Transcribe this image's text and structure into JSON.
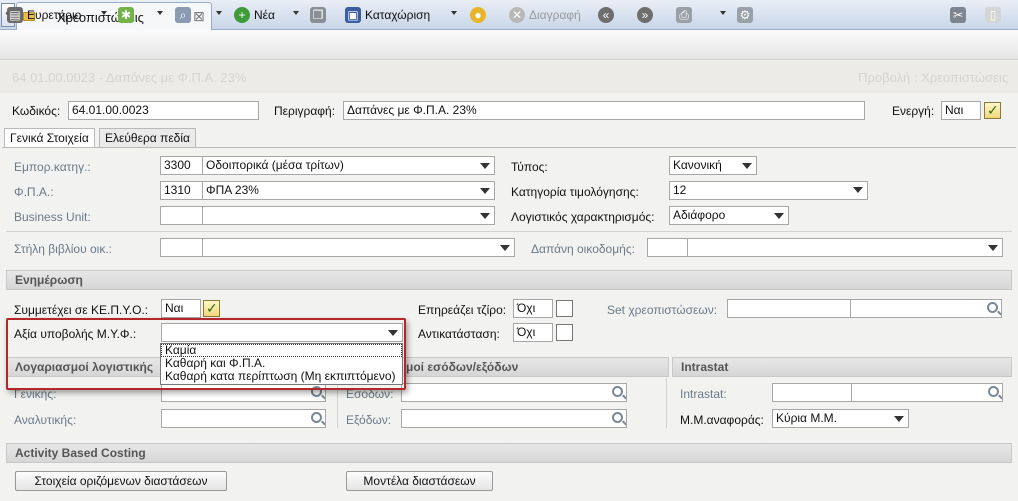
{
  "tabbar": {
    "tab_title": "Χρεοπιστώσεις",
    "close": "⊠"
  },
  "toolbar": {
    "index": "Ευρετήριο",
    "new": "Νέα",
    "save": "Καταχώριση",
    "delete": "Διαγραφή"
  },
  "record": {
    "code_and_desc": "64.01.00.0023 - Δαπάνες με Φ.Π.Α. 23%",
    "mode": "Προβολή : Χρεοπιστώσεις"
  },
  "header": {
    "code_label": "Κωδικός:",
    "code_value": "64.01.00.0023",
    "desc_label": "Περιγραφή:",
    "desc_value": "Δαπάνες με Φ.Π.Α. 23%",
    "active_label": "Ενεργή:",
    "active_value": "Ναι"
  },
  "tabs": [
    "Γενικά Στοιχεία",
    "Ελεύθερα πεδία"
  ],
  "general": {
    "emp_label": "Εμπορ.κατηγ.:",
    "emp_code": "3300",
    "emp_name": "Οδοιπορικά (μέσα τρίτων)",
    "vat_label": "Φ.Π.Α.:",
    "vat_code": "1310",
    "vat_name": "ΦΠΑ 23%",
    "bu_label": "Business Unit:",
    "type_label": "Τύπος:",
    "type_value": "Κανονική",
    "billcat_label": "Κατηγορία τιμολόγησης:",
    "billcat_value": "12",
    "acct_label": "Λογιστικός χαρακτηρισμός:",
    "acct_value": "Αδιάφορο",
    "col_label": "Στήλη βιβλίου οικ.:",
    "build_label": "Δαπάνη οικοδομής:"
  },
  "update": {
    "title": "Ενημέρωση",
    "kepyo_label": "Συμμετέχει σε ΚΕ.Π.Υ.Ο.:",
    "kepyo_value": "Ναι",
    "turnover_label": "Επηρεάζει τζίρο:",
    "turnover_value": "Όχι",
    "set_label": "Set χρεοπιστώσεων:",
    "myf_label": "Αξία υποβολής Μ.Υ.Φ.:",
    "replace_label": "Αντικατάσταση:",
    "replace_value": "Όχι"
  },
  "myf_options": [
    "Καμία",
    "Καθαρή και Φ.Π.Α.",
    "Καθαρή κατα περίπτωση (Μη εκπιπτόμενο)"
  ],
  "accounts": {
    "title": "Λογαριασμοί λογιστικής",
    "general_label": "Γενικής:",
    "analytic_label": "Αναλυτικής:"
  },
  "income": {
    "title": "Λογαριασμοί εσόδων/εξόδων",
    "title_visible": "μοί εσόδων/εξόδων",
    "income_label": "Εσόδων:",
    "expense_label": "Εξόδων:"
  },
  "intrastat": {
    "title": "Intrastat",
    "intrastat_label": "Intrastat:",
    "unit_label": "Μ.Μ.αναφοράς:",
    "unit_value": "Κύρια Μ.Μ."
  },
  "abc": {
    "title": "Activity Based Costing",
    "btn_dims": "Στοιχεία οριζόμενων διαστάσεων",
    "btn_models": "Μοντέλα διαστάσεων"
  }
}
